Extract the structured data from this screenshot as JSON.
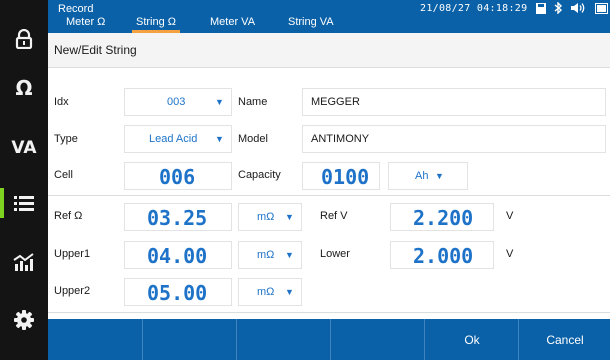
{
  "colors": {
    "header_bg": "#0a61a8",
    "sidebar_bg": "#141414",
    "sidebar_active": "#7ed321",
    "tab_underline": "#f5a142",
    "value_blue": "#1e73c8"
  },
  "sidebar": {
    "items": [
      {
        "icon": "lock-icon"
      },
      {
        "icon": "ohm-icon",
        "label": "Ω"
      },
      {
        "icon": "va-icon",
        "label": "VA"
      },
      {
        "icon": "list-icon",
        "active": true
      },
      {
        "icon": "chart-icon"
      },
      {
        "icon": "gear-icon"
      }
    ]
  },
  "header": {
    "title": "Record",
    "datetime": "21/08/27 04:18:29",
    "status_icons": [
      "save-icon",
      "bluetooth-icon",
      "volume-icon",
      "battery-icon"
    ],
    "tabs": [
      {
        "label": "Meter Ω",
        "active": false
      },
      {
        "label": "String Ω",
        "active": true
      },
      {
        "label": "Meter VA",
        "active": false
      },
      {
        "label": "String VA",
        "active": false
      }
    ]
  },
  "form": {
    "section_title": "New/Edit String",
    "idx": {
      "label": "Idx",
      "value": "003"
    },
    "name": {
      "label": "Name",
      "value": "MEGGER"
    },
    "type": {
      "label": "Type",
      "value": "Lead Acid"
    },
    "model": {
      "label": "Model",
      "value": "ANTIMONY"
    },
    "cell": {
      "label": "Cell",
      "value": "006"
    },
    "capacity": {
      "label": "Capacity",
      "value": "0100",
      "unit": "Ah"
    },
    "ref_ohm": {
      "label": "Ref Ω",
      "value": "03.25",
      "unit": "mΩ"
    },
    "ref_v": {
      "label": "Ref V",
      "value": "2.200",
      "unit": "V"
    },
    "upper1": {
      "label": "Upper1",
      "value": "04.00",
      "unit": "mΩ"
    },
    "lower": {
      "label": "Lower",
      "value": "2.000",
      "unit": "V"
    },
    "upper2": {
      "label": "Upper2",
      "value": "05.00",
      "unit": "mΩ"
    }
  },
  "footer": {
    "ok_label": "Ok",
    "cancel_label": "Cancel"
  }
}
